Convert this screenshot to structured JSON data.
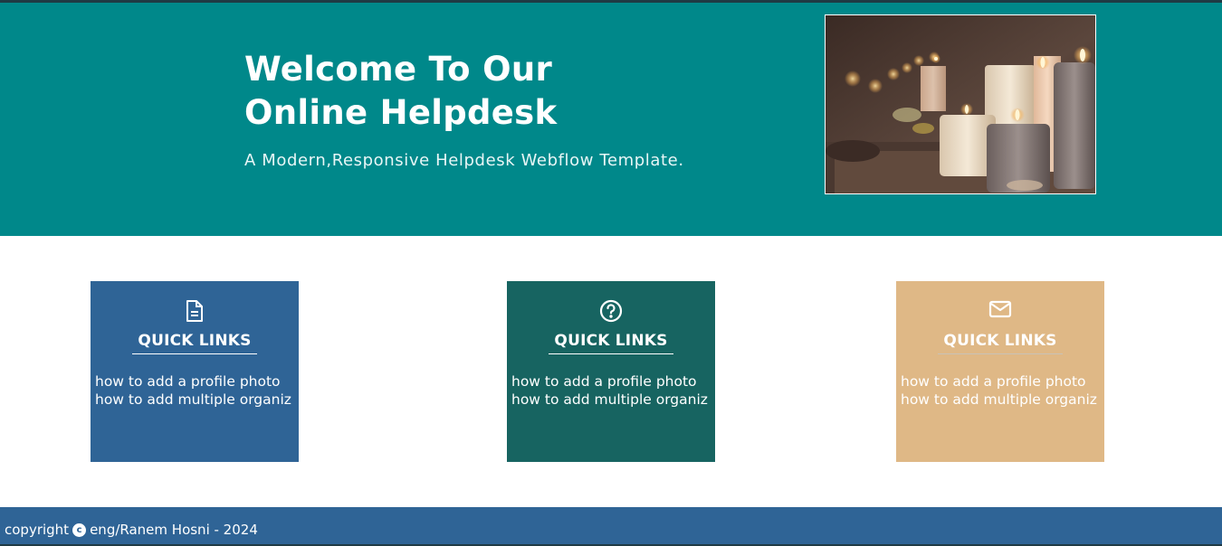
{
  "hero": {
    "title_line1": "Welcome To Our",
    "title_line2": "Online Helpdesk",
    "subtitle": "A Modern,Responsive Helpdesk Webflow Template.",
    "image_alt": "candles"
  },
  "cards": [
    {
      "icon": "document-icon",
      "title": "QUICK LINKS",
      "links": [
        "how to add a profile photo",
        "how to add multiple organiz"
      ],
      "color": "#2f6496"
    },
    {
      "icon": "question-circle-icon",
      "title": "QUICK LINKS",
      "links": [
        "how to add a profile photo",
        "how to add multiple organiz"
      ],
      "color": "#176461"
    },
    {
      "icon": "envelope-icon",
      "title": "QUICK LINKS",
      "links": [
        "how to add a profile photo",
        "how to add multiple organiz"
      ],
      "color": "#dfb886"
    }
  ],
  "footer": {
    "prefix": "copyright",
    "copyright_symbol": "c",
    "text": "eng/Ranem Hosni - 2024"
  },
  "colors": {
    "hero_bg": "#00888a",
    "footer_bg": "#2f6496"
  }
}
